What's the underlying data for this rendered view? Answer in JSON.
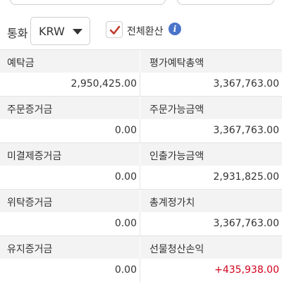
{
  "controls": {
    "currency_label": "통화",
    "currency_value": "KRW",
    "convert_all_label": "전체환산",
    "convert_all_checked": true
  },
  "rows": [
    {
      "left_label": "예탁금",
      "left_value": "2,950,425.00",
      "right_label": "평가예탁총액",
      "right_value": "3,367,763.00"
    },
    {
      "left_label": "주문증거금",
      "left_value": "0.00",
      "right_label": "주문가능금액",
      "right_value": "3,367,763.00"
    },
    {
      "left_label": "미결제증거금",
      "left_value": "0.00",
      "right_label": "인출가능금액",
      "right_value": "2,931,825.00"
    },
    {
      "left_label": "위탁증거금",
      "left_value": "0.00",
      "right_label": "총계정가치",
      "right_value": "3,367,763.00"
    },
    {
      "left_label": "유지증거금",
      "left_value": "0.00",
      "right_label": "선물청산손익",
      "right_value": "+435,938.00"
    }
  ],
  "colors": {
    "positive": "#d0021b",
    "accent": "#4a74c9",
    "check": "#c0392b"
  },
  "icons": {
    "dropdown": "triangle-down-icon",
    "check": "checkmark-icon",
    "info": "info-icon"
  }
}
